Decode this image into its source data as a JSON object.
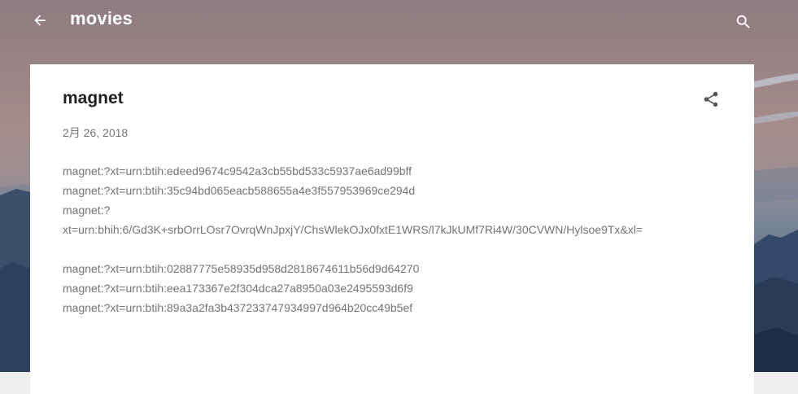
{
  "header": {
    "title": "movies",
    "back_icon": "arrow-left-icon",
    "search_icon": "search-icon"
  },
  "post": {
    "title": "magnet",
    "date": "2月 26, 2018",
    "share_icon": "share-icon",
    "lines": [
      "magnet:?xt=urn:btih:edeed9674c9542a3cb55bd533c5937ae6ad99bff",
      "magnet:?xt=urn:btih:35c94bd065eacb588655a4e3f557953969ce294d",
      "magnet:?",
      "xt=urn:bhih:6/Gd3K+srbOrrLOsr7OvrqWnJpxjY/ChsWlekOJx0fxtE1WRS/l7kJkUMf7Ri4W/30CVWN/Hylsoe9Tx&xl=",
      "",
      "magnet:?xt=urn:btih:02887775e58935d958d2818674611b56d9d64270",
      "magnet:?xt=urn:btih:eea173367e2f304dca27a8950a03e2495593d6f9",
      "magnet:?xt=urn:btih:89a3a2fa3b437233747934997d964b20cc49b5ef"
    ]
  },
  "colors": {
    "title_text": "#212121",
    "body_text": "#757575",
    "header_text": "#ffffff"
  }
}
